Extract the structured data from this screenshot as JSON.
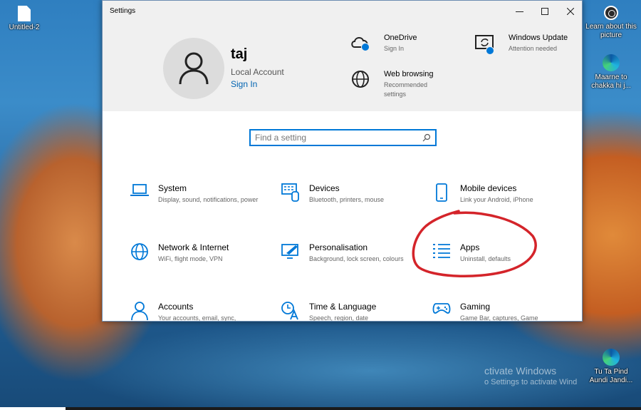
{
  "desktop": {
    "icons": [
      {
        "label": "Untitled-2",
        "icon": "file-icon"
      },
      {
        "label": "Learn about this picture",
        "icon": "camera-icon"
      },
      {
        "label": "Maarne to chakka hi j...",
        "icon": "edge-icon"
      },
      {
        "label": "Tu Ta Pind Aundi Jandi...",
        "icon": "edge-icon"
      }
    ],
    "watermark": {
      "line1": "ctivate Windows",
      "line2": "o Settings to activate Wind"
    }
  },
  "window": {
    "title": "Settings",
    "controls": {
      "minimize": "—",
      "maximize": "☐",
      "close": "✕"
    }
  },
  "profile": {
    "name": "taj",
    "account_type": "Local Account",
    "sign_in": "Sign In"
  },
  "header_items": [
    {
      "title": "OneDrive",
      "subtitle": "Sign In",
      "icon": "cloud-icon"
    },
    {
      "title": "Windows Update",
      "subtitle": "Attention needed",
      "icon": "update-icon"
    },
    {
      "title": "Web browsing",
      "subtitle": "Recommended settings",
      "icon": "globe-icon"
    }
  ],
  "search": {
    "placeholder": "Find a setting"
  },
  "categories": [
    {
      "title": "System",
      "subtitle": "Display, sound, notifications, power",
      "icon": "laptop-icon"
    },
    {
      "title": "Devices",
      "subtitle": "Bluetooth, printers, mouse",
      "icon": "keyboard-icon"
    },
    {
      "title": "Mobile devices",
      "subtitle": "Link your Android, iPhone",
      "icon": "phone-icon"
    },
    {
      "title": "Network & Internet",
      "subtitle": "WiFi, flight mode, VPN",
      "icon": "globe-icon"
    },
    {
      "title": "Personalisation",
      "subtitle": "Background, lock screen, colours",
      "icon": "paintbrush-icon"
    },
    {
      "title": "Apps",
      "subtitle": "Uninstall, defaults",
      "icon": "apps-list-icon"
    },
    {
      "title": "Accounts",
      "subtitle": "Your accounts, email, sync,",
      "icon": "person-icon"
    },
    {
      "title": "Time & Language",
      "subtitle": "Speech, region, date",
      "icon": "time-language-icon"
    },
    {
      "title": "Gaming",
      "subtitle": "Game Bar, captures, Game",
      "icon": "gamepad-icon"
    }
  ],
  "colors": {
    "accent": "#0078d7",
    "annotation": "#d4242a",
    "header_bg": "#f0f0f0"
  }
}
